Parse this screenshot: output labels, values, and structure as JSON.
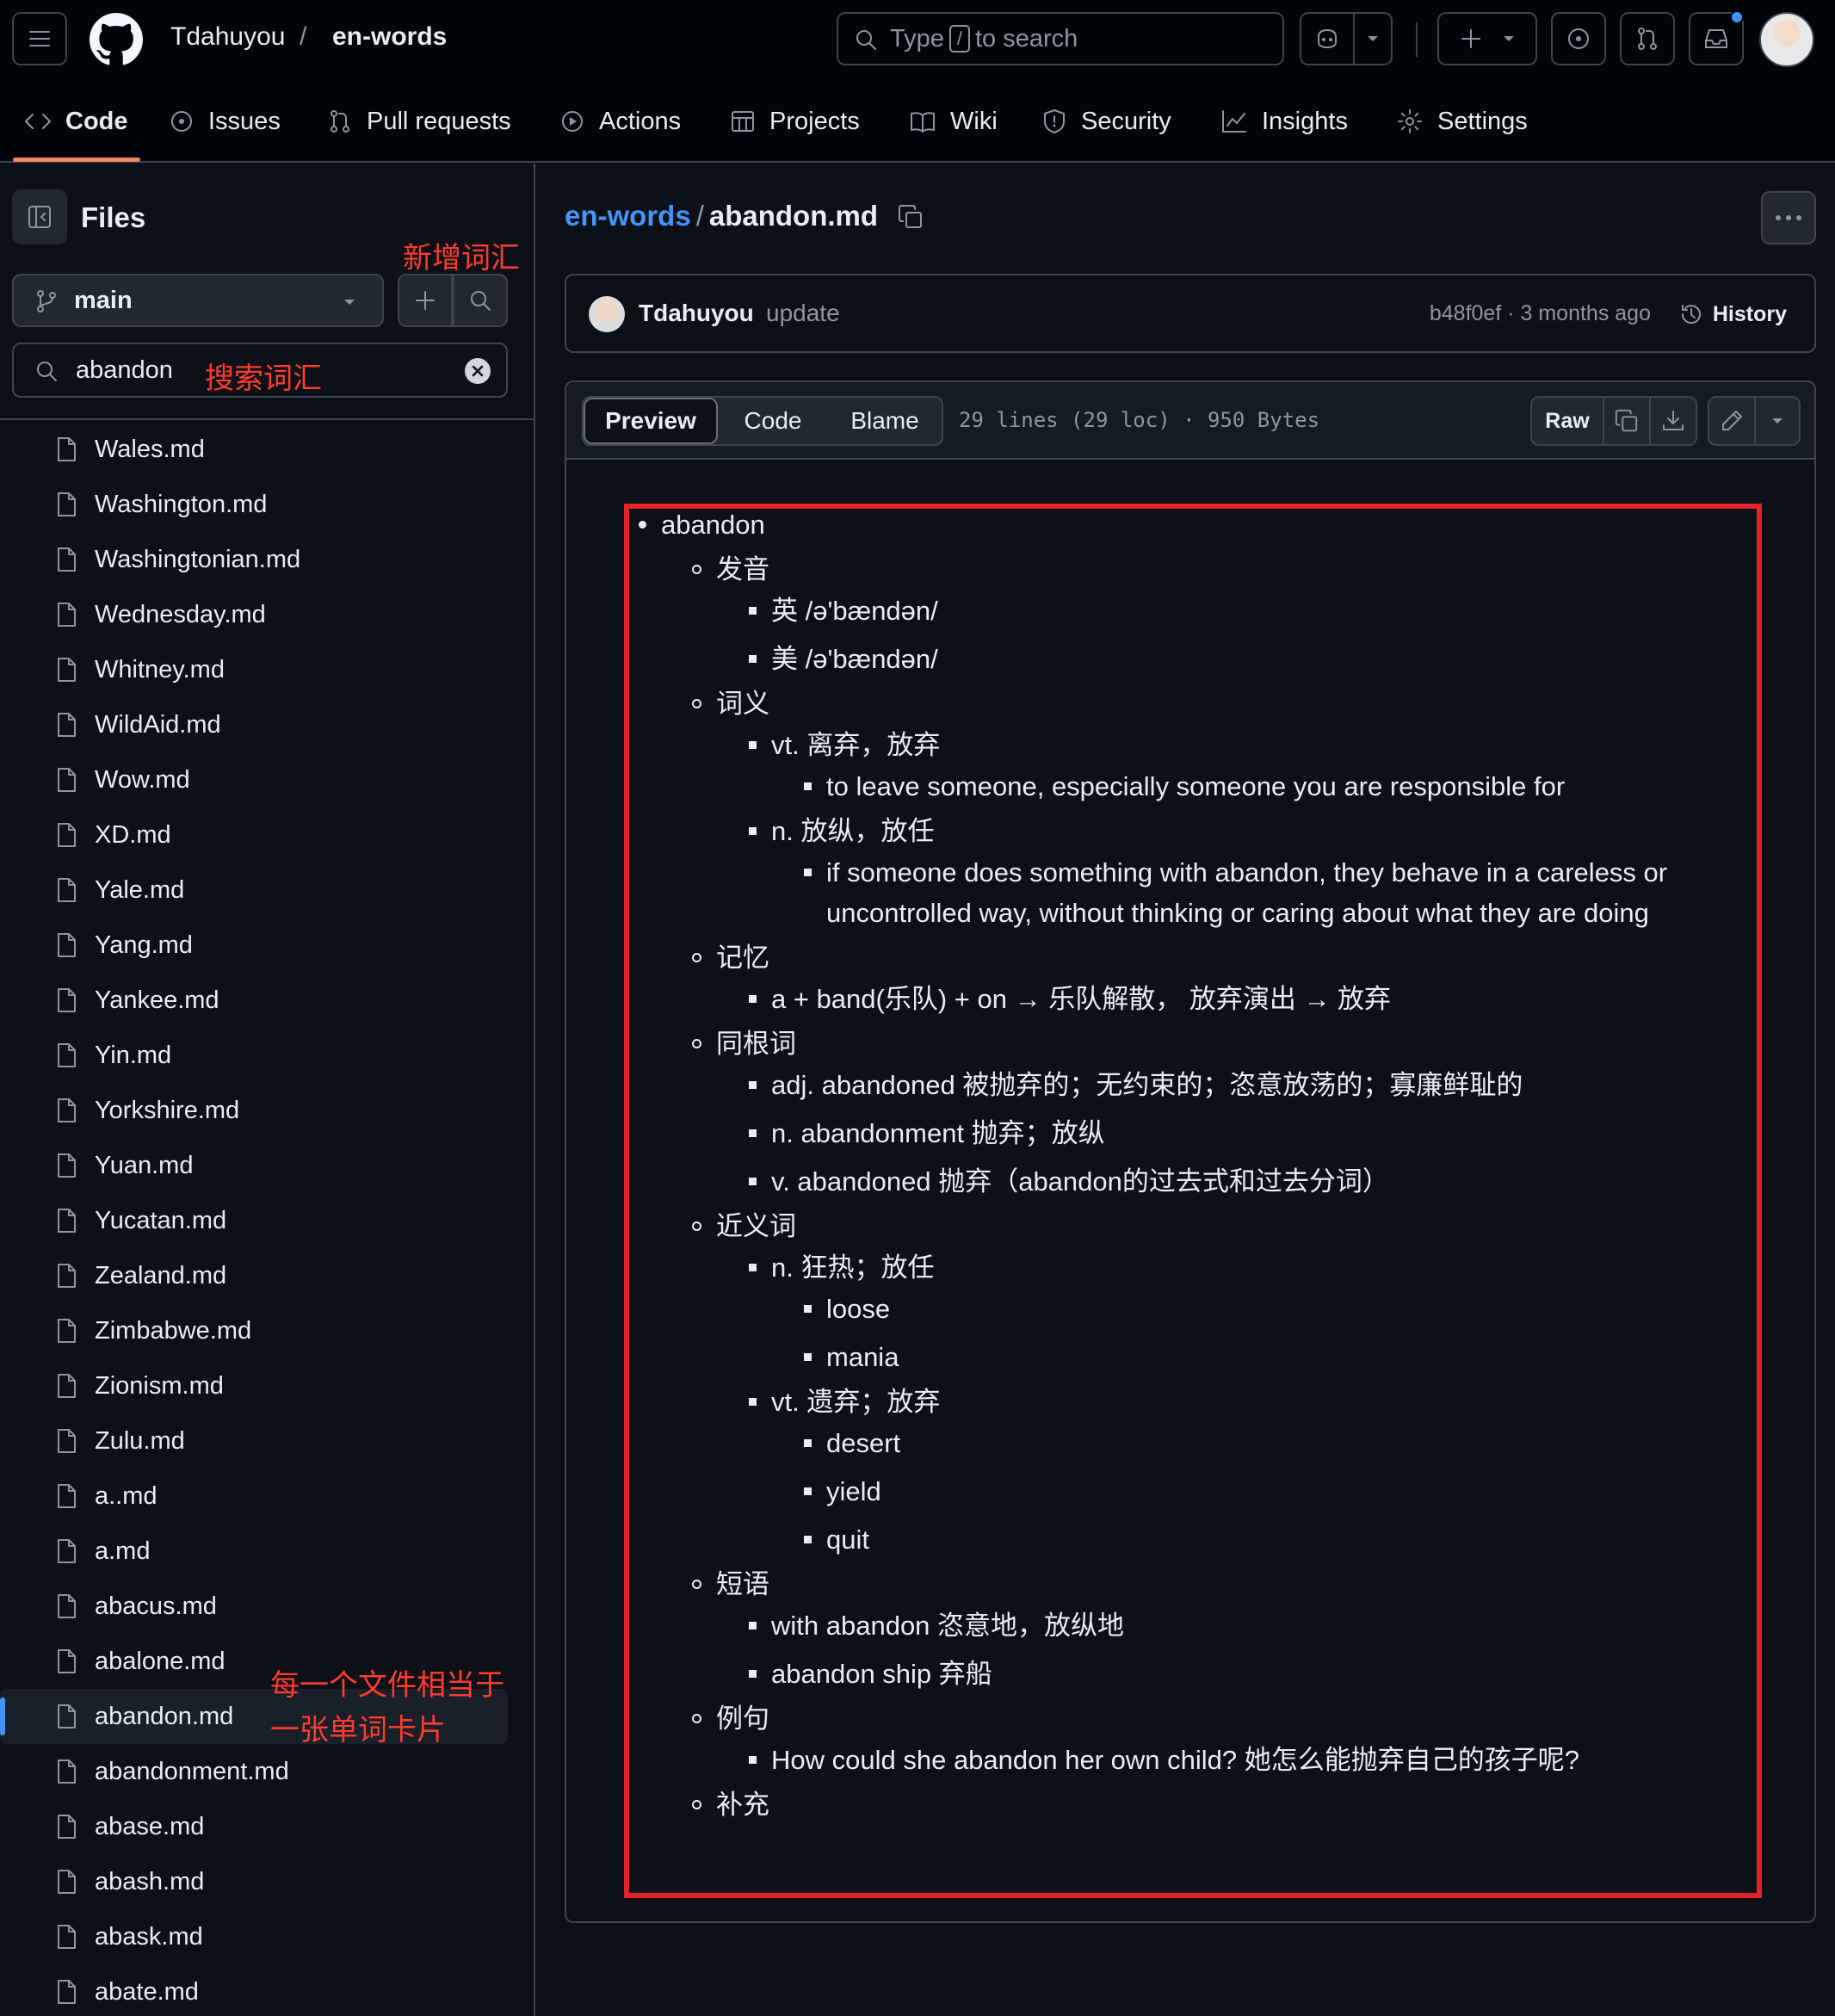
{
  "header": {
    "owner": "Tdahuyou",
    "separator": "/",
    "repo": "en-words",
    "search_prefix": "Type",
    "search_key": "/",
    "search_suffix": "to search"
  },
  "nav": {
    "tabs": [
      {
        "label": "Code",
        "icon": "code-icon"
      },
      {
        "label": "Issues",
        "icon": "issue-icon"
      },
      {
        "label": "Pull requests",
        "icon": "pull-request-icon"
      },
      {
        "label": "Actions",
        "icon": "play-icon"
      },
      {
        "label": "Projects",
        "icon": "table-icon"
      },
      {
        "label": "Wiki",
        "icon": "book-icon"
      },
      {
        "label": "Security",
        "icon": "shield-icon"
      },
      {
        "label": "Insights",
        "icon": "graph-icon"
      },
      {
        "label": "Settings",
        "icon": "gear-icon"
      }
    ]
  },
  "sidebar": {
    "title": "Files",
    "branch": "main",
    "filter_value": "abandon",
    "files": [
      "Wales.md",
      "Washington.md",
      "Washingtonian.md",
      "Wednesday.md",
      "Whitney.md",
      "WildAid.md",
      "Wow.md",
      "XD.md",
      "Yale.md",
      "Yang.md",
      "Yankee.md",
      "Yin.md",
      "Yorkshire.md",
      "Yuan.md",
      "Yucatan.md",
      "Zealand.md",
      "Zimbabwe.md",
      "Zionism.md",
      "Zulu.md",
      "a..md",
      "a.md",
      "abacus.md",
      "abalone.md",
      "abandon.md",
      "abandonment.md",
      "abase.md",
      "abash.md",
      "abask.md",
      "abate.md"
    ],
    "selected_file": "abandon.md"
  },
  "annotations": {
    "add_word": "新增词汇",
    "search_word": "搜索词汇",
    "card_line1": "每一个文件相当于",
    "card_line2": "一张单词卡片"
  },
  "file": {
    "repo_link": "en-words",
    "sep": "/",
    "name": "abandon.md"
  },
  "commit": {
    "author": "Tdahuyou",
    "message": "update",
    "meta": "b48f0ef · 3 months ago",
    "history_label": "History"
  },
  "viewer": {
    "tabs": [
      "Preview",
      "Code",
      "Blame"
    ],
    "info": "29 lines (29 loc) · 950 Bytes",
    "raw_label": "Raw"
  },
  "doc": [
    {
      "level": 1,
      "text": "abandon"
    },
    {
      "level": 2,
      "text": "发音"
    },
    {
      "level": 3,
      "text": "英 /ə'bændən/"
    },
    {
      "level": 3,
      "text": "美 /ə'bændən/"
    },
    {
      "level": 2,
      "text": "词义"
    },
    {
      "level": 3,
      "text": "vt. 离弃，放弃"
    },
    {
      "level": 4,
      "text": "to leave someone, especially someone you are responsible for"
    },
    {
      "level": 3,
      "text": "n. 放纵，放任"
    },
    {
      "level": 4,
      "text": "if someone does something with abandon, they behave in a careless or"
    },
    {
      "level": 5,
      "text": "uncontrolled way, without thinking or caring about what they are doing"
    },
    {
      "level": 2,
      "text": "记忆"
    },
    {
      "level": 3,
      "text": "a + band(乐队) + on → 乐队解散， 放弃演出 → 放弃"
    },
    {
      "level": 2,
      "text": "同根词"
    },
    {
      "level": 3,
      "text": "adj. abandoned 被抛弃的；无约束的；恣意放荡的；寡廉鲜耻的"
    },
    {
      "level": 3,
      "text": "n. abandonment 抛弃；放纵"
    },
    {
      "level": 3,
      "text": "v. abandoned 抛弃（abandon的过去式和过去分词）"
    },
    {
      "level": 2,
      "text": "近义词"
    },
    {
      "level": 3,
      "text": "n. 狂热；放任"
    },
    {
      "level": 4,
      "text": "loose"
    },
    {
      "level": 4,
      "text": "mania"
    },
    {
      "level": 3,
      "text": "vt. 遗弃；放弃"
    },
    {
      "level": 4,
      "text": "desert"
    },
    {
      "level": 4,
      "text": "yield"
    },
    {
      "level": 4,
      "text": "quit"
    },
    {
      "level": 2,
      "text": "短语"
    },
    {
      "level": 3,
      "text": "with abandon 恣意地，放纵地"
    },
    {
      "level": 3,
      "text": "abandon ship 弃船"
    },
    {
      "level": 2,
      "text": "例句"
    },
    {
      "level": 3,
      "text": "How could she abandon her own child? 她怎么能抛弃自己的孩子呢?"
    },
    {
      "level": 2,
      "text": "补充"
    }
  ],
  "colors": {
    "accent_underline": "#f78166",
    "link": "#4493f8",
    "annotation_red": "#ff3b30",
    "highlight_box": "#e5222a"
  }
}
